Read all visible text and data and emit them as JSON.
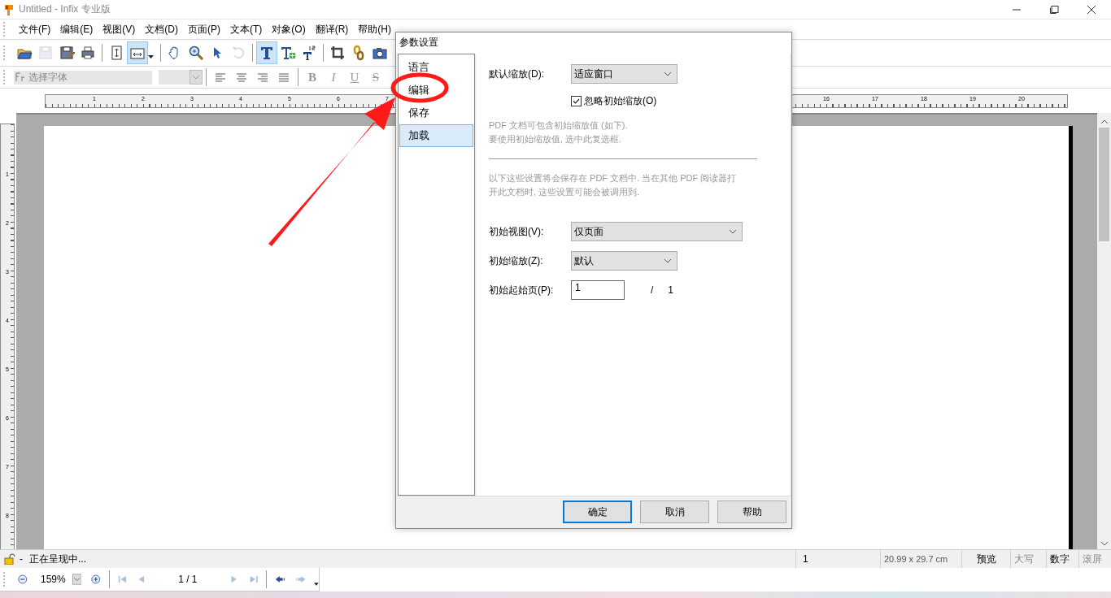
{
  "window": {
    "title": "Untitled - Infix 专业版"
  },
  "menu": [
    "文件(F)",
    "编辑(E)",
    "视图(V)",
    "文档(D)",
    "页面(P)",
    "文本(T)",
    "对象(O)",
    "翻译(R)",
    "帮助(H)"
  ],
  "toolbar": [
    {
      "selected": false,
      "disabled": false
    },
    {
      "selected": false,
      "disabled": true
    },
    {
      "selected": false,
      "disabled": false
    },
    {
      "selected": false,
      "disabled": false
    },
    {
      "selected": false,
      "disabled": false
    },
    {
      "selected": true,
      "disabled": false
    },
    {
      "selected": false,
      "disabled": false
    },
    {
      "selected": false,
      "disabled": false
    },
    {
      "selected": false,
      "disabled": false
    },
    {
      "selected": false,
      "disabled": true
    },
    {
      "selected": true,
      "disabled": false
    },
    {
      "selected": false,
      "disabled": false
    },
    {
      "selected": false,
      "disabled": false
    },
    {
      "selected": false,
      "disabled": false
    },
    {
      "selected": false,
      "disabled": false
    },
    {
      "selected": false,
      "disabled": false
    }
  ],
  "format_bar": {
    "font": {
      "placeholder": "选择字体"
    },
    "style_buttons": [
      "B",
      "I",
      "U",
      "S"
    ]
  },
  "ruler": {
    "left_labels": [
      "1",
      "2",
      "3",
      "4",
      "5",
      "6",
      "7"
    ],
    "right_labels": [
      "16",
      "17",
      "18",
      "19",
      "20"
    ]
  },
  "vertical_ruler": {
    "labels": [
      "1",
      "2",
      "3",
      "4",
      "5",
      "6",
      "7",
      "8"
    ]
  },
  "dialog": {
    "title": "参数设置",
    "categories": [
      {
        "label": "语言",
        "selected": false
      },
      {
        "label": "编辑",
        "selected": false
      },
      {
        "label": "保存",
        "selected": false
      },
      {
        "label": "加载",
        "selected": true
      }
    ],
    "default_zoom": {
      "label": "默认缩放(D):",
      "value": "适应窗口"
    },
    "ignore_zoom": {
      "label": "忽略初始缩放(O)",
      "checked": true
    },
    "note": [
      "PDF 文档可包含初始缩放值 (如下).",
      "要使用初始缩放值, 选中此复选框."
    ],
    "info": [
      "以下这些设置将会保存在 PDF 文档中. 当在其他 PDF 阅读器打",
      "开此文档时, 这些设置可能会被调用到."
    ],
    "initial_view": {
      "label": "初始视图(V):",
      "value": "仅页面"
    },
    "initial_zoom": {
      "label": "初始缩放(Z):",
      "value": "默认"
    },
    "start_page": {
      "label": "初始起始页(P):",
      "value": "1",
      "separator": "/",
      "total": "1"
    },
    "buttons": [
      {
        "label": "确定",
        "default": true
      },
      {
        "label": "取消",
        "default": false
      },
      {
        "label": "帮助",
        "default": false
      }
    ]
  },
  "status_bar": {
    "lock": "-",
    "message": "正在呈现中...",
    "cells": [
      {
        "text": "1",
        "on": true
      },
      {
        "text": "20.99 x 29.7 cm",
        "on": true
      },
      {
        "text": "预览",
        "on": true
      },
      {
        "text": "大写",
        "on": false
      },
      {
        "text": "数字",
        "on": true
      },
      {
        "text": "滚屏",
        "on": false
      }
    ]
  },
  "nav_bar": {
    "zoom": "159%",
    "page": "1 / 1"
  }
}
